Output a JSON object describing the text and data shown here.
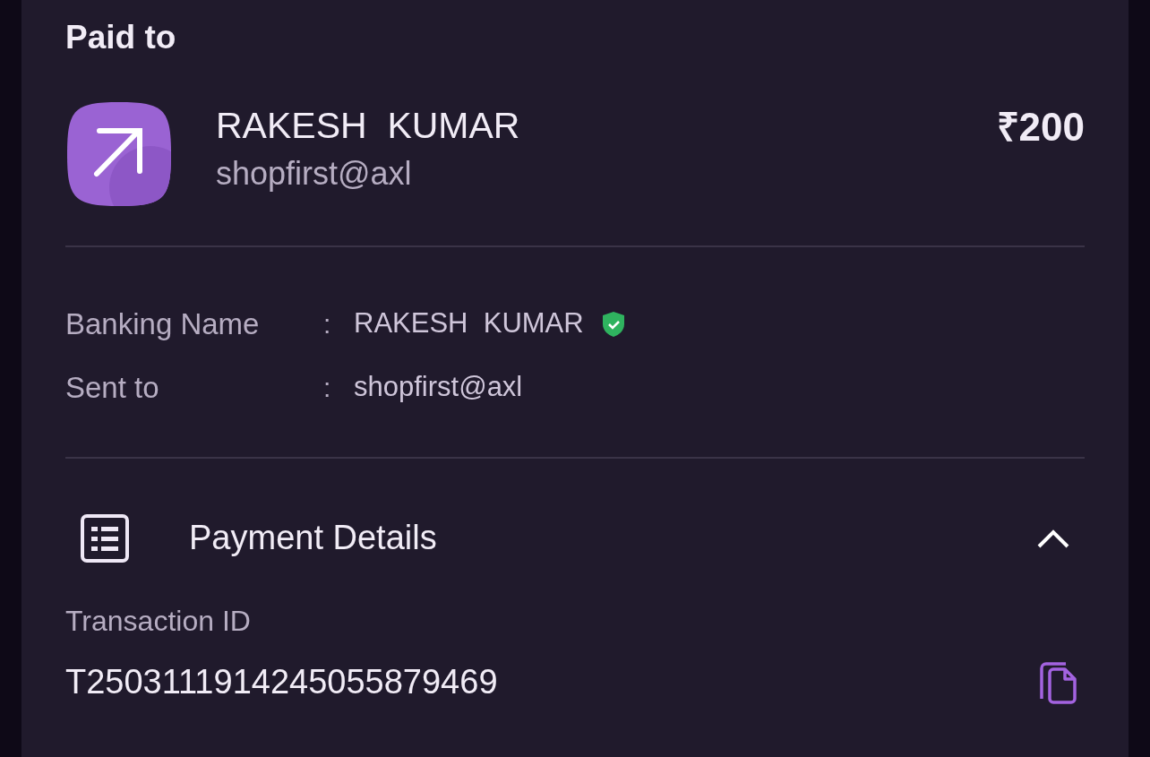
{
  "section_title": "Paid to",
  "payee": {
    "name": "RAKESH  KUMAR",
    "upi_id": "shopfirst@axl",
    "amount": "₹200"
  },
  "details": [
    {
      "label": "Banking Name",
      "separator": ":",
      "value": "RAKESH  KUMAR",
      "verified": true
    },
    {
      "label": "Sent to",
      "separator": ":",
      "value": "shopfirst@axl",
      "verified": false
    }
  ],
  "payment_details": {
    "title": "Payment Details",
    "expanded": true,
    "transaction_label": "Transaction ID",
    "transaction_id": "T2503111914245055879469"
  }
}
